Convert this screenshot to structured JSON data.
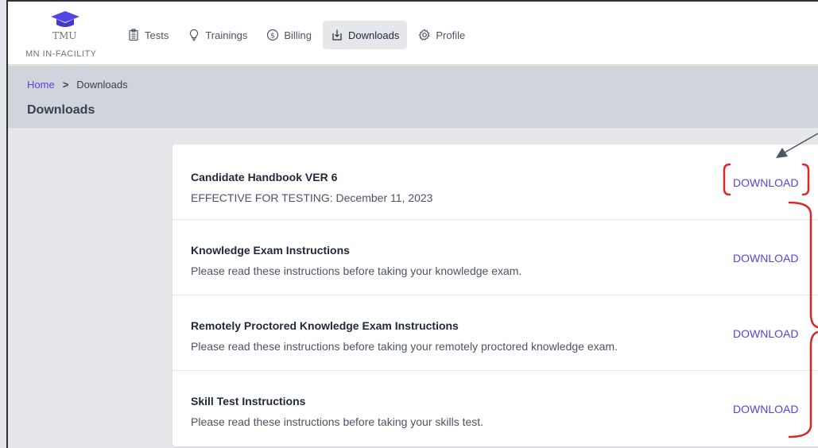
{
  "header": {
    "logo_text": "TMU",
    "logo_sub": "MN IN-FACILITY",
    "nav": [
      {
        "label": "Tests",
        "icon": "clipboard-icon",
        "active": false
      },
      {
        "label": "Trainings",
        "icon": "lightbulb-icon",
        "active": false
      },
      {
        "label": "Billing",
        "icon": "dollar-icon",
        "active": false
      },
      {
        "label": "Downloads",
        "icon": "download-icon",
        "active": true
      },
      {
        "label": "Profile",
        "icon": "gear-icon",
        "active": false
      }
    ]
  },
  "breadcrumb": {
    "home": "Home",
    "separator": ">",
    "current": "Downloads"
  },
  "page_title": "Downloads",
  "downloads": [
    {
      "title": "Candidate Handbook VER 6",
      "subtitle": "EFFECTIVE FOR TESTING: December 11, 2023",
      "action": "DOWNLOAD"
    },
    {
      "title": "Knowledge Exam Instructions",
      "subtitle": "Please read these instructions before taking your knowledge exam.",
      "action": "DOWNLOAD"
    },
    {
      "title": "Remotely Proctored Knowledge Exam Instructions",
      "subtitle": "Please read these instructions before taking your remotely proctored knowledge exam.",
      "action": "DOWNLOAD"
    },
    {
      "title": "Skill Test Instructions",
      "subtitle": "Please read these instructions before taking your skills test.",
      "action": "DOWNLOAD"
    }
  ],
  "colors": {
    "accent": "#4f46e5",
    "annotation_red": "#dc2626",
    "annotation_arrow": "#4b5563"
  }
}
